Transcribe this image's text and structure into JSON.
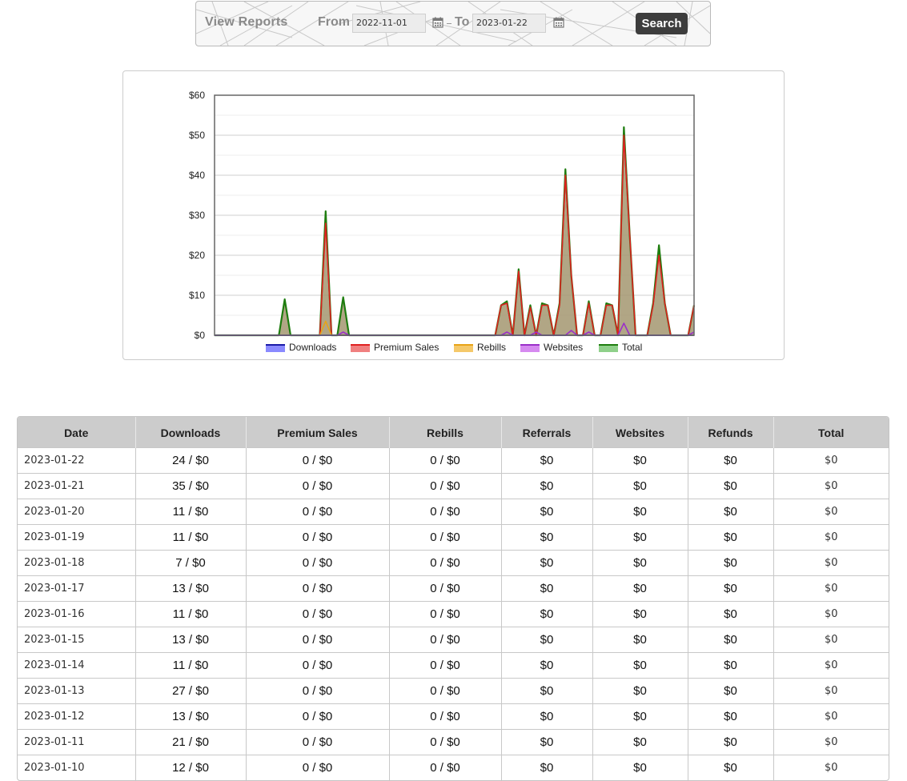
{
  "filter": {
    "title": "View Reports",
    "from_label": "From",
    "from_value": "2022-11-01",
    "to_label": "To",
    "to_value": "2023-01-22",
    "search_label": "Search"
  },
  "chart_data": {
    "type": "area",
    "ylim": [
      0,
      60
    ],
    "y_ticks": [
      "$0",
      "$10",
      "$20",
      "$30",
      "$40",
      "$50",
      "$60"
    ],
    "legend_placement": "bottom",
    "x_count": 83,
    "series": [
      {
        "name": "Downloads",
        "color": "#1a1aa8",
        "fill": "#8a8aff",
        "values": []
      },
      {
        "name": "Premium Sales",
        "color": "#e02020",
        "fill": "#f08080",
        "values": [
          0,
          0,
          0,
          0,
          0,
          0,
          0,
          0,
          0,
          0,
          0,
          0,
          0,
          0,
          0,
          0,
          0,
          0,
          0,
          28,
          0,
          0,
          0,
          0,
          0,
          0,
          0,
          0,
          0,
          0,
          0,
          0,
          0,
          0,
          0,
          0,
          0,
          0,
          0,
          0,
          0,
          0,
          0,
          0,
          0,
          0,
          0,
          0,
          0,
          7.5,
          8,
          0,
          16,
          0,
          7,
          0,
          7.5,
          7.5,
          0,
          7.5,
          40,
          15,
          0,
          0,
          8,
          0,
          0,
          7.5,
          7.5,
          0,
          50,
          25,
          0,
          0,
          0,
          7.5,
          20,
          8,
          0,
          0,
          0,
          0,
          7.5
        ]
      },
      {
        "name": "Rebills",
        "color": "#e8a317",
        "fill": "#f5c96a",
        "values": [
          0,
          0,
          0,
          0,
          0,
          0,
          0,
          0,
          0,
          0,
          0,
          0,
          0,
          0,
          0,
          0,
          0,
          0,
          0,
          3.5,
          0,
          0,
          0,
          0,
          0,
          0,
          0,
          0,
          0,
          0,
          0,
          0,
          0,
          0,
          0,
          0,
          0,
          0,
          0,
          0,
          0,
          0,
          0,
          0,
          0,
          0,
          0,
          0,
          0,
          0,
          0,
          0,
          0,
          0,
          0,
          0,
          0,
          0,
          0,
          0,
          0,
          0,
          0,
          0,
          0,
          0,
          0,
          0,
          0,
          0,
          0,
          0,
          0,
          0,
          0,
          0,
          0,
          0,
          0,
          0,
          0,
          0,
          0
        ]
      },
      {
        "name": "Websites",
        "color": "#9b2fc9",
        "fill": "#d68af0",
        "values": [
          0,
          0,
          0,
          0,
          0,
          0,
          0,
          0,
          0,
          0,
          0,
          0,
          0,
          0,
          0,
          0,
          0,
          0,
          0,
          0,
          0,
          0,
          0.8,
          0,
          0,
          0,
          0,
          0,
          0,
          0,
          0,
          0,
          0,
          0,
          0,
          0,
          0,
          0,
          0,
          0,
          0,
          0,
          0,
          0,
          0,
          0,
          0,
          0,
          0,
          0,
          0.8,
          0,
          0,
          0,
          0,
          0.8,
          0,
          0,
          0,
          0,
          0,
          1.2,
          0,
          0,
          0.8,
          0,
          0,
          0,
          0,
          0,
          3,
          0,
          0,
          0,
          0,
          0,
          0,
          0,
          0,
          0,
          0,
          0,
          0.8
        ]
      },
      {
        "name": "Total",
        "color": "#1e7d0f",
        "fill": "#8fd08a",
        "values": [
          0,
          0,
          0,
          0,
          0,
          0,
          0,
          0,
          0,
          0,
          0,
          0,
          9,
          0,
          0,
          0,
          0,
          0,
          0,
          31,
          0,
          0,
          9.5,
          0,
          0,
          0,
          0,
          0,
          0,
          0,
          0,
          0,
          0,
          0,
          0,
          0,
          0,
          0,
          0,
          0,
          0,
          0,
          0,
          0,
          0,
          0,
          0,
          0,
          0,
          7.5,
          8.5,
          0,
          16.5,
          0,
          7.5,
          0,
          8,
          7.5,
          0,
          8,
          41.5,
          15,
          0,
          0,
          8.5,
          0,
          0,
          8,
          7.5,
          0,
          52,
          25,
          0,
          0,
          0,
          8,
          22.5,
          8,
          0,
          0,
          0,
          0,
          7.5
        ]
      }
    ]
  },
  "table": {
    "headers": [
      "Date",
      "Downloads",
      "Premium Sales",
      "Rebills",
      "Referrals",
      "Websites",
      "Refunds",
      "Total"
    ],
    "rows": [
      [
        "2023-01-22",
        "24 / $0",
        "0 / $0",
        "0 / $0",
        "$0",
        "$0",
        "$0",
        "$0"
      ],
      [
        "2023-01-21",
        "35 / $0",
        "0 / $0",
        "0 / $0",
        "$0",
        "$0",
        "$0",
        "$0"
      ],
      [
        "2023-01-20",
        "11 / $0",
        "0 / $0",
        "0 / $0",
        "$0",
        "$0",
        "$0",
        "$0"
      ],
      [
        "2023-01-19",
        "11 / $0",
        "0 / $0",
        "0 / $0",
        "$0",
        "$0",
        "$0",
        "$0"
      ],
      [
        "2023-01-18",
        "7 / $0",
        "0 / $0",
        "0 / $0",
        "$0",
        "$0",
        "$0",
        "$0"
      ],
      [
        "2023-01-17",
        "13 / $0",
        "0 / $0",
        "0 / $0",
        "$0",
        "$0",
        "$0",
        "$0"
      ],
      [
        "2023-01-16",
        "11 / $0",
        "0 / $0",
        "0 / $0",
        "$0",
        "$0",
        "$0",
        "$0"
      ],
      [
        "2023-01-15",
        "13 / $0",
        "0 / $0",
        "0 / $0",
        "$0",
        "$0",
        "$0",
        "$0"
      ],
      [
        "2023-01-14",
        "11 / $0",
        "0 / $0",
        "0 / $0",
        "$0",
        "$0",
        "$0",
        "$0"
      ],
      [
        "2023-01-13",
        "27 / $0",
        "0 / $0",
        "0 / $0",
        "$0",
        "$0",
        "$0",
        "$0"
      ],
      [
        "2023-01-12",
        "13 / $0",
        "0 / $0",
        "0 / $0",
        "$0",
        "$0",
        "$0",
        "$0"
      ],
      [
        "2023-01-11",
        "21 / $0",
        "0 / $0",
        "0 / $0",
        "$0",
        "$0",
        "$0",
        "$0"
      ],
      [
        "2023-01-10",
        "12 / $0",
        "0 / $0",
        "0 / $0",
        "$0",
        "$0",
        "$0",
        "$0"
      ]
    ]
  }
}
